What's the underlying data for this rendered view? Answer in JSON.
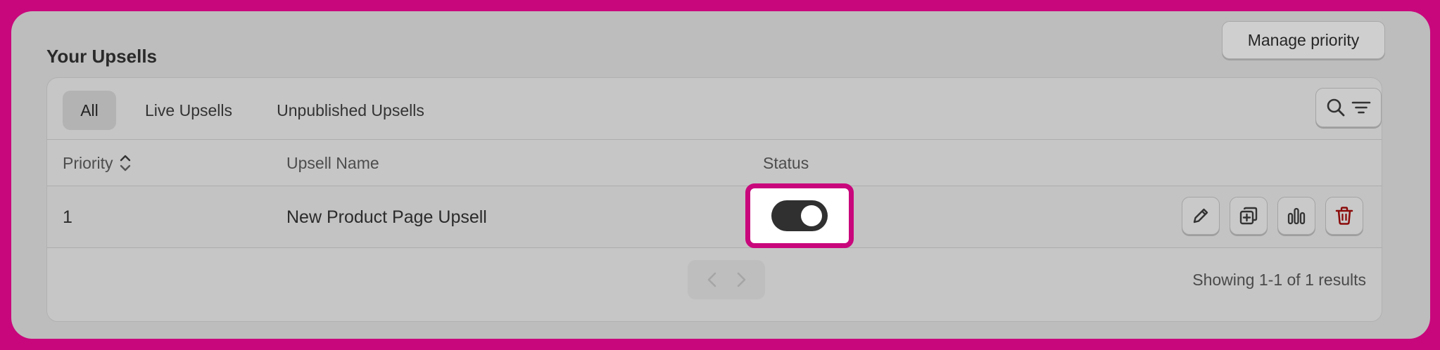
{
  "page": {
    "title": "Your Upsells",
    "manage_priority_label": "Manage priority"
  },
  "tabs": [
    {
      "label": "All",
      "active": true
    },
    {
      "label": "Live Upsells",
      "active": false
    },
    {
      "label": "Unpublished Upsells",
      "active": false
    }
  ],
  "toolbar": {
    "icons": [
      "search-icon",
      "filter-icon"
    ]
  },
  "table": {
    "columns": [
      "Priority",
      "Upsell Name",
      "Status"
    ],
    "sort_icon": "sort-up-down-icon",
    "rows": [
      {
        "priority": "1",
        "name": "New Product Page Upsell",
        "status_on": true,
        "actions": [
          "edit-icon",
          "duplicate-icon",
          "analytics-icon",
          "delete-icon"
        ]
      }
    ]
  },
  "pagination": {
    "prev_icon": "chevron-left-icon",
    "next_icon": "chevron-right-icon",
    "results_text": "Showing 1-1 of 1 results"
  },
  "colors": {
    "highlight": "#c9077c",
    "toggle_on": "#303030",
    "delete": "#8b0a0a"
  }
}
